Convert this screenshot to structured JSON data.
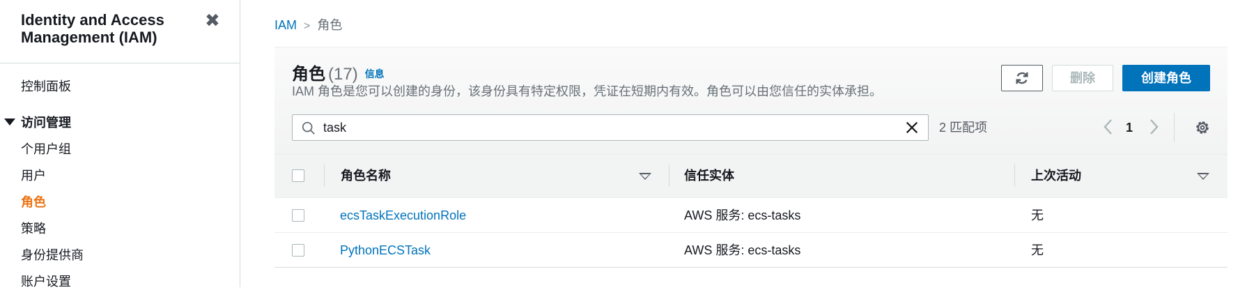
{
  "sidebar": {
    "title": "Identity and Access Management (IAM)",
    "dashboard": "控制面板",
    "section": "访问管理",
    "items": [
      {
        "label": "个用户组"
      },
      {
        "label": "用户"
      },
      {
        "label": "角色"
      },
      {
        "label": "策略"
      },
      {
        "label": "身份提供商"
      },
      {
        "label": "账户设置"
      }
    ],
    "active_item": "角色"
  },
  "breadcrumb": {
    "root": "IAM",
    "current": "角色"
  },
  "header": {
    "title": "角色",
    "count": "(17)",
    "info": "信息",
    "description": "IAM 角色是您可以创建的身份，该身份具有特定权限，凭证在短期内有效。角色可以由您信任的实体承担。"
  },
  "actions": {
    "delete": "删除",
    "create": "创建角色"
  },
  "search": {
    "value": "task",
    "matches": "2 匹配项"
  },
  "pagination": {
    "page": "1"
  },
  "table": {
    "columns": [
      "角色名称",
      "信任实体",
      "上次活动"
    ],
    "rows": [
      {
        "name": "ecsTaskExecutionRole",
        "trusted": "AWS 服务: ecs-tasks",
        "last": "无"
      },
      {
        "name": "PythonECSTask",
        "trusted": "AWS 服务: ecs-tasks",
        "last": "无"
      }
    ]
  },
  "colors": {
    "accent": "#0073bb",
    "active_nav": "#ec7211"
  }
}
